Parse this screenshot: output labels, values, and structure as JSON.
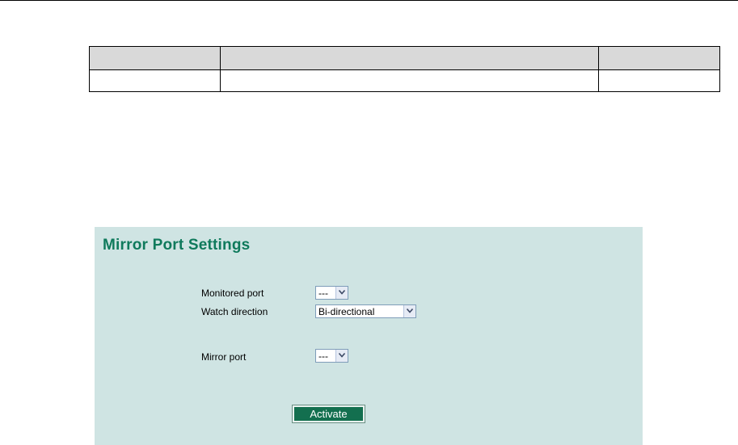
{
  "panel": {
    "title": "Mirror Port Settings",
    "bg_color": "#cfe4e3",
    "title_color": "#0f7a5c"
  },
  "form": {
    "monitored_port": {
      "label": "Monitored port",
      "value": "---"
    },
    "watch_direction": {
      "label": "Watch direction",
      "value": "Bi-directional"
    },
    "mirror_port": {
      "label": "Mirror port",
      "value": "---"
    },
    "activate_label": "Activate",
    "button_color": "#136f4f"
  },
  "icons": {
    "select_arrow": "chevron-down-icon"
  }
}
